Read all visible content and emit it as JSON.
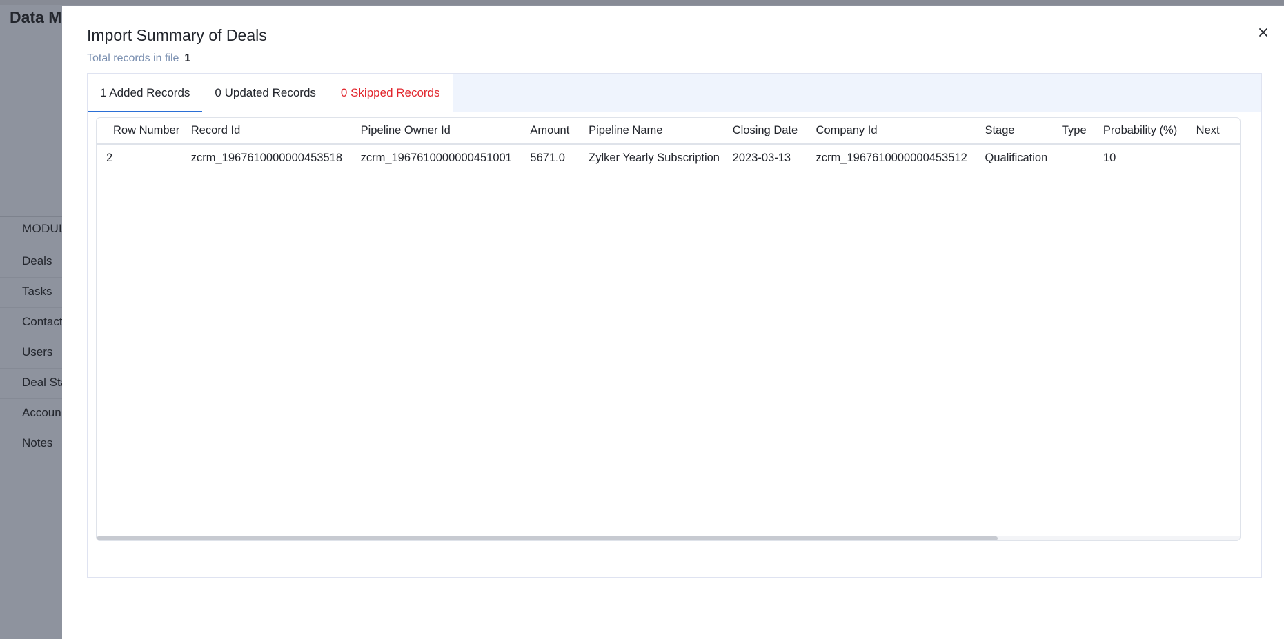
{
  "background": {
    "app_title": "Data M",
    "modules_label": "MODUL",
    "modules": [
      "Deals",
      "Tasks",
      "Contact",
      "Users",
      "Deal Sta",
      "Accoun",
      "Notes"
    ]
  },
  "modal": {
    "title": "Import Summary of Deals",
    "subtitle_label": "Total records in file",
    "subtitle_count": "1",
    "close_icon": "close-icon",
    "tabs": [
      {
        "label": "1 Added Records",
        "state": "active"
      },
      {
        "label": "0 Updated Records",
        "state": "inactive"
      },
      {
        "label": "0 Skipped Records",
        "state": "skipped"
      }
    ],
    "table": {
      "columns": [
        "Row Number",
        "Record Id",
        "Pipeline Owner Id",
        "Amount",
        "Pipeline Name",
        "Closing Date",
        "Company Id",
        "Stage",
        "Type",
        "Probability (%)",
        "Next"
      ],
      "rows": [
        [
          "2",
          "zcrm_1967610000000453518",
          "zcrm_1967610000000451001",
          "5671.0",
          "Zylker Yearly Subscription",
          "2023-03-13",
          "zcrm_1967610000000453512",
          "Qualification",
          "",
          "10",
          ""
        ]
      ]
    }
  },
  "colors": {
    "accent": "#2b6fd6",
    "skipped": "#e1262d",
    "subtitle": "#7a8fb0",
    "tab_bar": "#eff4fd"
  }
}
